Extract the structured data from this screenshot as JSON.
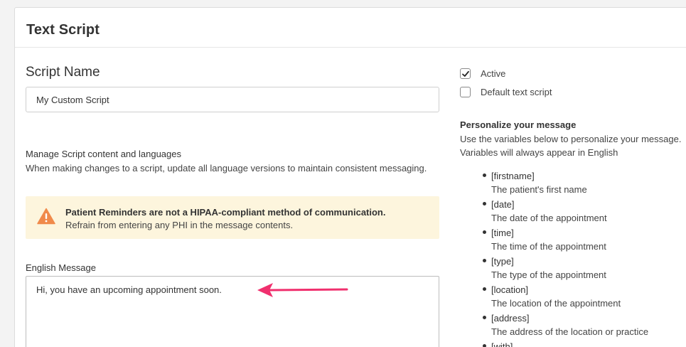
{
  "header": {
    "title": "Text Script"
  },
  "script_name": {
    "label": "Script Name",
    "value": "My Custom Script"
  },
  "manage": {
    "title": "Manage Script content and languages",
    "description": "When making changes to a script, update all language versions to maintain consistent messaging."
  },
  "warning": {
    "icon": "warning-triangle-icon",
    "title": "Patient Reminders are not a HIPAA-compliant method of communication.",
    "text": "Refrain from entering any PHI in the message contents.",
    "color": "#f08a4b"
  },
  "english_message": {
    "label": "English Message",
    "value": "Hi, you have an upcoming appointment soon."
  },
  "annotation": {
    "color": "#f0306e"
  },
  "options": {
    "active": {
      "label": "Active",
      "checked": true
    },
    "default": {
      "label": "Default text script",
      "checked": false
    }
  },
  "personalize": {
    "title": "Personalize your message",
    "description": "Use the variables below to personalize your message. Variables will always appear in English",
    "variables": [
      {
        "name": "[firstname]",
        "desc": "The patient's first name"
      },
      {
        "name": "[date]",
        "desc": "The date of the appointment"
      },
      {
        "name": "[time]",
        "desc": "The time of the appointment"
      },
      {
        "name": "[type]",
        "desc": "The type of the appointment"
      },
      {
        "name": "[location]",
        "desc": "The location of the appointment"
      },
      {
        "name": "[address]",
        "desc": "The address of the location or practice"
      },
      {
        "name": "[with]",
        "desc": ""
      }
    ]
  }
}
